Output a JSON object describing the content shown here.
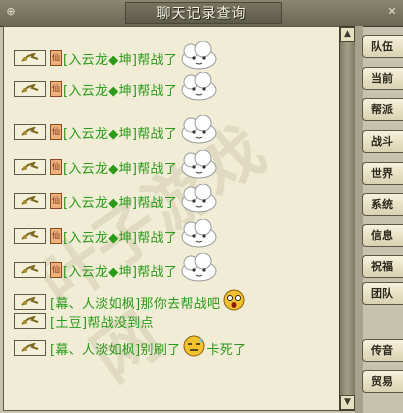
{
  "window": {
    "title": "聊天记录查询",
    "close_glyph": "✕",
    "pin_glyph": "⊕"
  },
  "messages": [
    {
      "role_glyph": "仙",
      "name": "[入云龙◆坤]",
      "text": "帮战了",
      "emoji": "cloud-face"
    },
    {
      "role_glyph": "仙",
      "name": "[入云龙◆坤]",
      "text": "帮战了",
      "emoji": "cloud-face"
    },
    {
      "role_glyph": "仙",
      "name": "[入云龙◆坤]",
      "text": "帮战了",
      "emoji": "cloud-face"
    },
    {
      "role_glyph": "仙",
      "name": "[入云龙◆坤]",
      "text": "帮战了",
      "emoji": "cloud-face"
    },
    {
      "role_glyph": "仙",
      "name": "[入云龙◆坤]",
      "text": "帮战了",
      "emoji": "cloud-face"
    },
    {
      "role_glyph": "仙",
      "name": "[入云龙◆坤]",
      "text": "帮战了",
      "emoji": "cloud-face"
    },
    {
      "role_glyph": "仙",
      "name": "[入云龙◆坤]",
      "text": "帮战了",
      "emoji": "cloud-face"
    },
    {
      "role_glyph": "",
      "name": "[幕、人淡如枫]",
      "text": "那你去帮战吧",
      "emoji": "surprised-face"
    },
    {
      "role_glyph": "",
      "name": "[土豆]",
      "text": "帮战没到点",
      "emoji": ""
    },
    {
      "role_glyph": "",
      "name": "[幕、人淡如枫]",
      "text": "别刷了",
      "emoji": "sweat-face",
      "text_after": "卡死了"
    }
  ],
  "tabs": [
    "队伍",
    "当前",
    "帮派",
    "战斗",
    "世界",
    "系统",
    "信息",
    "祝福",
    "团队",
    "传音",
    "贸易"
  ],
  "scroll": {
    "up": "▲",
    "down": "▼"
  },
  "watermark": "叶子游戏网"
}
